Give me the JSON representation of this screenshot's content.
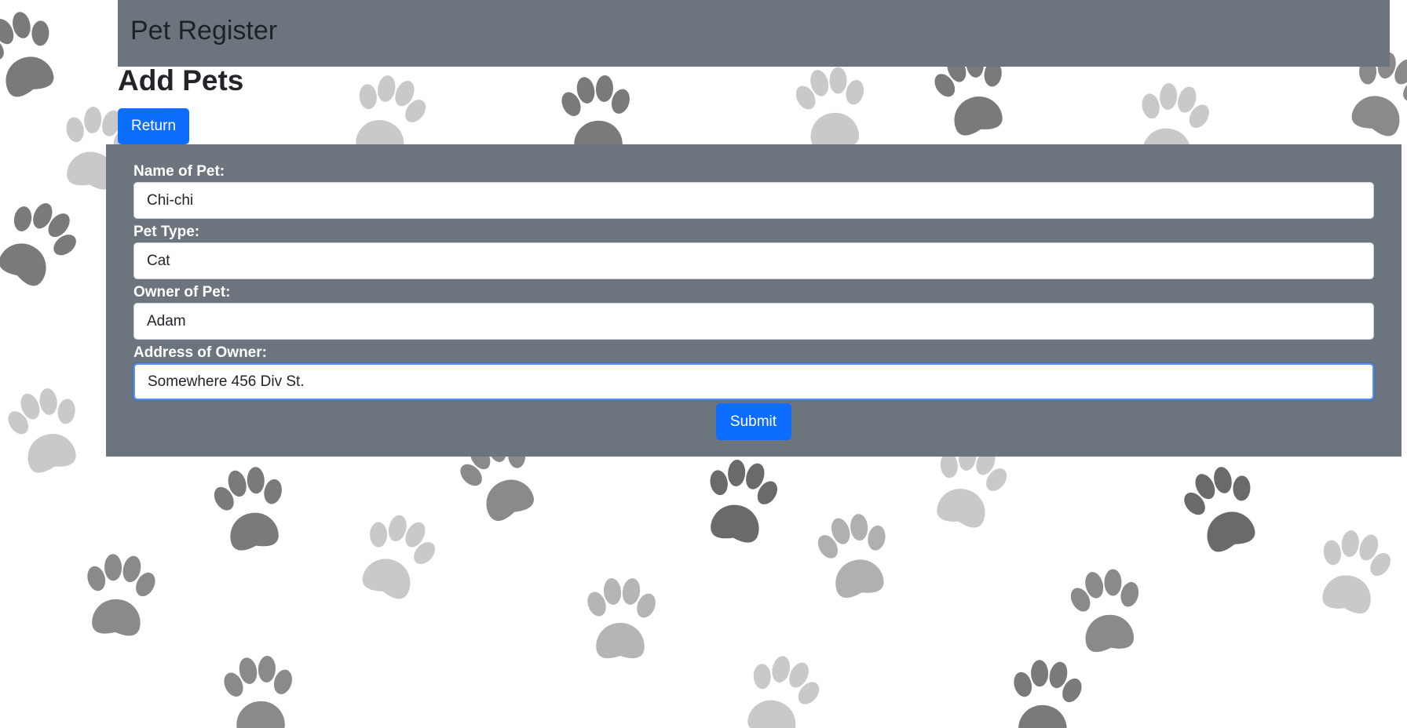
{
  "navbar": {
    "brand": "Pet Register"
  },
  "page": {
    "heading": "Add Pets",
    "return_label": "Return"
  },
  "form": {
    "fields": [
      {
        "label": "Name of Pet:",
        "value": "Chi-chi"
      },
      {
        "label": "Pet Type:",
        "value": "Cat"
      },
      {
        "label": "Owner of Pet:",
        "value": "Adam"
      },
      {
        "label": "Address of Owner:",
        "value": "Somewhere 456 Div St."
      }
    ],
    "submit_label": "Submit"
  },
  "colors": {
    "panel": "#6c757d",
    "primary": "#0d6efd",
    "background": "#ffffff"
  },
  "background_icon": "paw-print-icon"
}
